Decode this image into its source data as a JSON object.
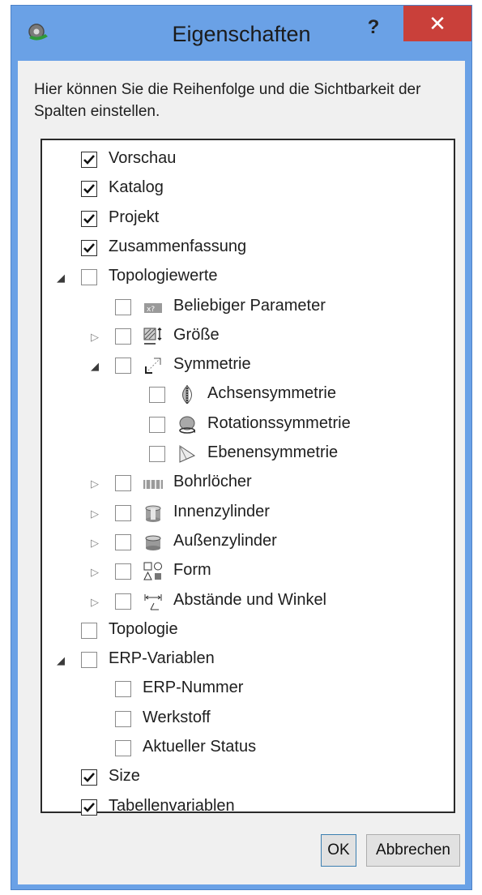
{
  "window": {
    "title": "Eigenschaften",
    "help_label": "?",
    "close_label": "✕",
    "accent": "#6aa1e6",
    "close_color": "#c9403a"
  },
  "description": "Hier können Sie die Reihenfolge und die Sichtbarkeit der Spalten einstellen.",
  "tree": [
    {
      "label": "Vorschau",
      "checked": true,
      "depth": 0,
      "expander": "none",
      "icon": null
    },
    {
      "label": "Katalog",
      "checked": true,
      "depth": 0,
      "expander": "none",
      "icon": null
    },
    {
      "label": "Projekt",
      "checked": true,
      "depth": 0,
      "expander": "none",
      "icon": null
    },
    {
      "label": "Zusammenfassung",
      "checked": true,
      "depth": 0,
      "expander": "none",
      "icon": null
    },
    {
      "label": "Topologiewerte",
      "checked": false,
      "depth": 0,
      "expander": "expanded",
      "icon": null
    },
    {
      "label": "Beliebiger Parameter",
      "checked": false,
      "depth": 1,
      "expander": "none",
      "icon": "parameter-icon"
    },
    {
      "label": "Größe",
      "checked": false,
      "depth": 1,
      "expander": "collapsed",
      "icon": "size-icon"
    },
    {
      "label": "Symmetrie",
      "checked": false,
      "depth": 1,
      "expander": "expanded",
      "icon": "symmetry-icon"
    },
    {
      "label": "Achsensymmetrie",
      "checked": false,
      "depth": 2,
      "expander": "none",
      "icon": "axis-symmetry-icon"
    },
    {
      "label": "Rotationssymmetrie",
      "checked": false,
      "depth": 2,
      "expander": "none",
      "icon": "rotation-symmetry-icon"
    },
    {
      "label": "Ebenensymmetrie",
      "checked": false,
      "depth": 2,
      "expander": "none",
      "icon": "plane-symmetry-icon"
    },
    {
      "label": "Bohrlöcher",
      "checked": false,
      "depth": 1,
      "expander": "collapsed",
      "icon": "holes-icon"
    },
    {
      "label": "Innenzylinder",
      "checked": false,
      "depth": 1,
      "expander": "collapsed",
      "icon": "inner-cylinder-icon"
    },
    {
      "label": "Außenzylinder",
      "checked": false,
      "depth": 1,
      "expander": "collapsed",
      "icon": "outer-cylinder-icon"
    },
    {
      "label": "Form",
      "checked": false,
      "depth": 1,
      "expander": "collapsed",
      "icon": "shape-icon"
    },
    {
      "label": "Abstände und Winkel",
      "checked": false,
      "depth": 1,
      "expander": "collapsed",
      "icon": "distance-angle-icon"
    },
    {
      "label": "Topologie",
      "checked": false,
      "depth": 0,
      "expander": "none",
      "icon": null
    },
    {
      "label": "ERP-Variablen",
      "checked": false,
      "depth": 0,
      "expander": "expanded",
      "icon": null
    },
    {
      "label": "ERP-Nummer",
      "checked": false,
      "depth": 1,
      "expander": "none",
      "icon": null
    },
    {
      "label": "Werkstoff",
      "checked": false,
      "depth": 1,
      "expander": "none",
      "icon": null
    },
    {
      "label": "Aktueller Status",
      "checked": false,
      "depth": 1,
      "expander": "none",
      "icon": null
    },
    {
      "label": "Size",
      "checked": true,
      "depth": 0,
      "expander": "none",
      "icon": null
    },
    {
      "label": "Tabellenvariablen",
      "checked": true,
      "depth": 0,
      "expander": "none",
      "icon": null
    }
  ],
  "buttons": {
    "ok_label": "OK",
    "cancel_label": "Abbrechen"
  }
}
